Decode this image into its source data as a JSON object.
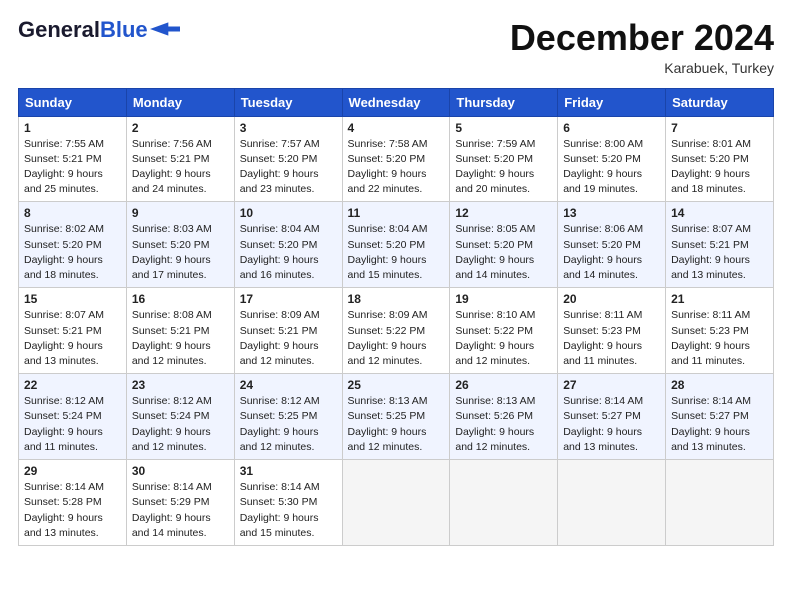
{
  "header": {
    "logo_line1": "General",
    "logo_line2": "Blue",
    "month": "December 2024",
    "location": "Karabuek, Turkey"
  },
  "weekdays": [
    "Sunday",
    "Monday",
    "Tuesday",
    "Wednesday",
    "Thursday",
    "Friday",
    "Saturday"
  ],
  "weeks": [
    [
      {
        "day": "1",
        "sunrise": "Sunrise: 7:55 AM",
        "sunset": "Sunset: 5:21 PM",
        "daylight": "Daylight: 9 hours and 25 minutes."
      },
      {
        "day": "2",
        "sunrise": "Sunrise: 7:56 AM",
        "sunset": "Sunset: 5:21 PM",
        "daylight": "Daylight: 9 hours and 24 minutes."
      },
      {
        "day": "3",
        "sunrise": "Sunrise: 7:57 AM",
        "sunset": "Sunset: 5:20 PM",
        "daylight": "Daylight: 9 hours and 23 minutes."
      },
      {
        "day": "4",
        "sunrise": "Sunrise: 7:58 AM",
        "sunset": "Sunset: 5:20 PM",
        "daylight": "Daylight: 9 hours and 22 minutes."
      },
      {
        "day": "5",
        "sunrise": "Sunrise: 7:59 AM",
        "sunset": "Sunset: 5:20 PM",
        "daylight": "Daylight: 9 hours and 20 minutes."
      },
      {
        "day": "6",
        "sunrise": "Sunrise: 8:00 AM",
        "sunset": "Sunset: 5:20 PM",
        "daylight": "Daylight: 9 hours and 19 minutes."
      },
      {
        "day": "7",
        "sunrise": "Sunrise: 8:01 AM",
        "sunset": "Sunset: 5:20 PM",
        "daylight": "Daylight: 9 hours and 18 minutes."
      }
    ],
    [
      {
        "day": "8",
        "sunrise": "Sunrise: 8:02 AM",
        "sunset": "Sunset: 5:20 PM",
        "daylight": "Daylight: 9 hours and 18 minutes."
      },
      {
        "day": "9",
        "sunrise": "Sunrise: 8:03 AM",
        "sunset": "Sunset: 5:20 PM",
        "daylight": "Daylight: 9 hours and 17 minutes."
      },
      {
        "day": "10",
        "sunrise": "Sunrise: 8:04 AM",
        "sunset": "Sunset: 5:20 PM",
        "daylight": "Daylight: 9 hours and 16 minutes."
      },
      {
        "day": "11",
        "sunrise": "Sunrise: 8:04 AM",
        "sunset": "Sunset: 5:20 PM",
        "daylight": "Daylight: 9 hours and 15 minutes."
      },
      {
        "day": "12",
        "sunrise": "Sunrise: 8:05 AM",
        "sunset": "Sunset: 5:20 PM",
        "daylight": "Daylight: 9 hours and 14 minutes."
      },
      {
        "day": "13",
        "sunrise": "Sunrise: 8:06 AM",
        "sunset": "Sunset: 5:20 PM",
        "daylight": "Daylight: 9 hours and 14 minutes."
      },
      {
        "day": "14",
        "sunrise": "Sunrise: 8:07 AM",
        "sunset": "Sunset: 5:21 PM",
        "daylight": "Daylight: 9 hours and 13 minutes."
      }
    ],
    [
      {
        "day": "15",
        "sunrise": "Sunrise: 8:07 AM",
        "sunset": "Sunset: 5:21 PM",
        "daylight": "Daylight: 9 hours and 13 minutes."
      },
      {
        "day": "16",
        "sunrise": "Sunrise: 8:08 AM",
        "sunset": "Sunset: 5:21 PM",
        "daylight": "Daylight: 9 hours and 12 minutes."
      },
      {
        "day": "17",
        "sunrise": "Sunrise: 8:09 AM",
        "sunset": "Sunset: 5:21 PM",
        "daylight": "Daylight: 9 hours and 12 minutes."
      },
      {
        "day": "18",
        "sunrise": "Sunrise: 8:09 AM",
        "sunset": "Sunset: 5:22 PM",
        "daylight": "Daylight: 9 hours and 12 minutes."
      },
      {
        "day": "19",
        "sunrise": "Sunrise: 8:10 AM",
        "sunset": "Sunset: 5:22 PM",
        "daylight": "Daylight: 9 hours and 12 minutes."
      },
      {
        "day": "20",
        "sunrise": "Sunrise: 8:11 AM",
        "sunset": "Sunset: 5:23 PM",
        "daylight": "Daylight: 9 hours and 11 minutes."
      },
      {
        "day": "21",
        "sunrise": "Sunrise: 8:11 AM",
        "sunset": "Sunset: 5:23 PM",
        "daylight": "Daylight: 9 hours and 11 minutes."
      }
    ],
    [
      {
        "day": "22",
        "sunrise": "Sunrise: 8:12 AM",
        "sunset": "Sunset: 5:24 PM",
        "daylight": "Daylight: 9 hours and 11 minutes."
      },
      {
        "day": "23",
        "sunrise": "Sunrise: 8:12 AM",
        "sunset": "Sunset: 5:24 PM",
        "daylight": "Daylight: 9 hours and 12 minutes."
      },
      {
        "day": "24",
        "sunrise": "Sunrise: 8:12 AM",
        "sunset": "Sunset: 5:25 PM",
        "daylight": "Daylight: 9 hours and 12 minutes."
      },
      {
        "day": "25",
        "sunrise": "Sunrise: 8:13 AM",
        "sunset": "Sunset: 5:25 PM",
        "daylight": "Daylight: 9 hours and 12 minutes."
      },
      {
        "day": "26",
        "sunrise": "Sunrise: 8:13 AM",
        "sunset": "Sunset: 5:26 PM",
        "daylight": "Daylight: 9 hours and 12 minutes."
      },
      {
        "day": "27",
        "sunrise": "Sunrise: 8:14 AM",
        "sunset": "Sunset: 5:27 PM",
        "daylight": "Daylight: 9 hours and 13 minutes."
      },
      {
        "day": "28",
        "sunrise": "Sunrise: 8:14 AM",
        "sunset": "Sunset: 5:27 PM",
        "daylight": "Daylight: 9 hours and 13 minutes."
      }
    ],
    [
      {
        "day": "29",
        "sunrise": "Sunrise: 8:14 AM",
        "sunset": "Sunset: 5:28 PM",
        "daylight": "Daylight: 9 hours and 13 minutes."
      },
      {
        "day": "30",
        "sunrise": "Sunrise: 8:14 AM",
        "sunset": "Sunset: 5:29 PM",
        "daylight": "Daylight: 9 hours and 14 minutes."
      },
      {
        "day": "31",
        "sunrise": "Sunrise: 8:14 AM",
        "sunset": "Sunset: 5:30 PM",
        "daylight": "Daylight: 9 hours and 15 minutes."
      },
      null,
      null,
      null,
      null
    ]
  ]
}
